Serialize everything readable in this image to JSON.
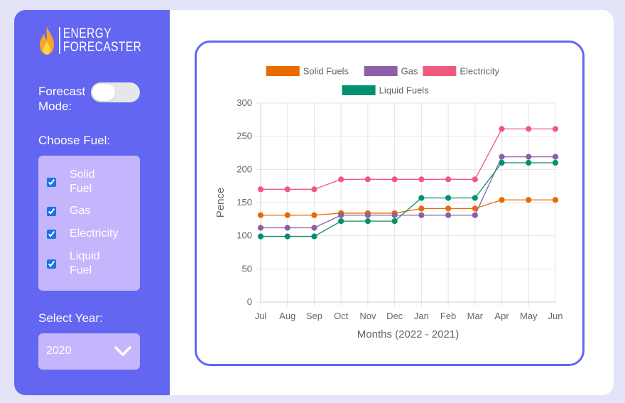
{
  "app": {
    "logo_line1": "ENERGY",
    "logo_line2": "FORECASTER"
  },
  "sidebar": {
    "forecast_mode_label_1": "Forecast",
    "forecast_mode_label_2": "Mode:",
    "forecast_mode_on": false,
    "choose_fuel_label": "Choose Fuel:",
    "fuels": [
      {
        "line1": "Solid",
        "line2": "Fuel",
        "checked": true
      },
      {
        "line1": "Gas",
        "line2": "",
        "checked": true
      },
      {
        "line1": "Electricity",
        "line2": "",
        "checked": true
      },
      {
        "line1": "Liquid",
        "line2": "Fuel",
        "checked": true
      }
    ],
    "select_year_label": "Select Year:",
    "selected_year": "2020"
  },
  "colors": {
    "accent": "#6366f1",
    "panel_light": "#c4b5fd"
  },
  "chart_data": {
    "type": "line",
    "categories": [
      "Jul",
      "Aug",
      "Sep",
      "Oct",
      "Nov",
      "Dec",
      "Jan",
      "Feb",
      "Mar",
      "Apr",
      "May",
      "Jun"
    ],
    "xlabel": "Months (2022 - 2021)",
    "ylabel": "Pence",
    "ylim": [
      0,
      300
    ],
    "yticks": [
      0,
      50,
      100,
      150,
      200,
      250,
      300
    ],
    "grid": true,
    "legend_position": "top",
    "series": [
      {
        "name": "Solid Fuels",
        "color": "#ea6a00",
        "values": [
          131,
          131,
          131,
          134,
          134,
          134,
          141,
          141,
          141,
          154,
          154,
          154
        ]
      },
      {
        "name": "Gas",
        "color": "#8e5ea8",
        "values": [
          112,
          112,
          112,
          131,
          131,
          131,
          131,
          131,
          131,
          219,
          219,
          219
        ]
      },
      {
        "name": "Electricity",
        "color": "#ef5a7e",
        "values": [
          170,
          170,
          170,
          185,
          185,
          185,
          185,
          185,
          185,
          261,
          261,
          261
        ]
      },
      {
        "name": "Liquid Fuels",
        "color": "#05906f",
        "values": [
          99,
          99,
          99,
          122,
          122,
          122,
          157,
          157,
          157,
          210,
          210,
          210
        ]
      }
    ]
  }
}
